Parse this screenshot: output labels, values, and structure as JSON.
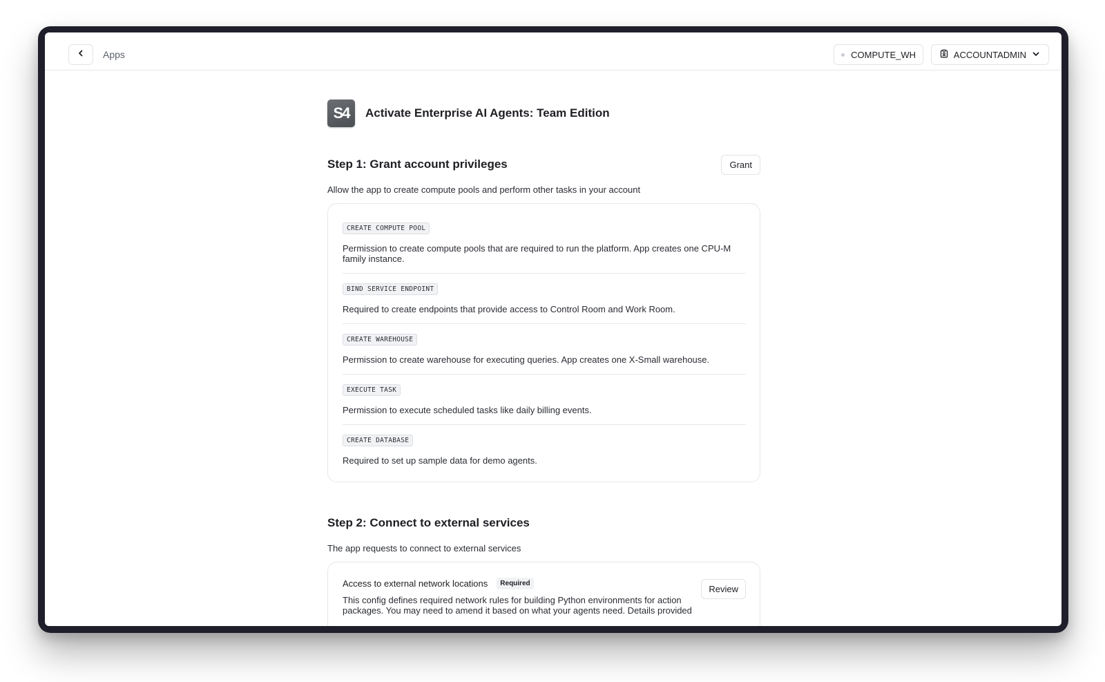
{
  "topbar": {
    "breadcrumb": "Apps",
    "warehouse": "COMPUTE_WH",
    "role": "ACCOUNTADMIN"
  },
  "app": {
    "logo_text": "S4",
    "title": "Activate Enterprise AI Agents: Team Edition"
  },
  "step1": {
    "title": "Step 1: Grant account privileges",
    "button": "Grant",
    "description": "Allow the app to create compute pools and perform other tasks in your account",
    "privileges": [
      {
        "code": "CREATE COMPUTE POOL",
        "desc": "Permission to create compute pools that are required to run the platform. App creates one CPU-M family instance."
      },
      {
        "code": "BIND SERVICE ENDPOINT",
        "desc": "Required to create endpoints that provide access to Control Room and Work Room."
      },
      {
        "code": "CREATE WAREHOUSE",
        "desc": "Permission to create warehouse for executing queries. App creates one X-Small warehouse."
      },
      {
        "code": "EXECUTE TASK",
        "desc": "Permission to execute scheduled tasks like daily billing events."
      },
      {
        "code": "CREATE DATABASE",
        "desc": "Required to set up sample data for demo agents."
      }
    ]
  },
  "step2": {
    "title": "Step 2: Connect to external services",
    "description": "The app requests to connect to external services",
    "item": {
      "title": "Access to external network locations",
      "badge": "Required",
      "desc": "This config defines required network rules for building Python environments for action packages. You may need to amend it based on what your agents need. Details provided",
      "button": "Review"
    }
  }
}
